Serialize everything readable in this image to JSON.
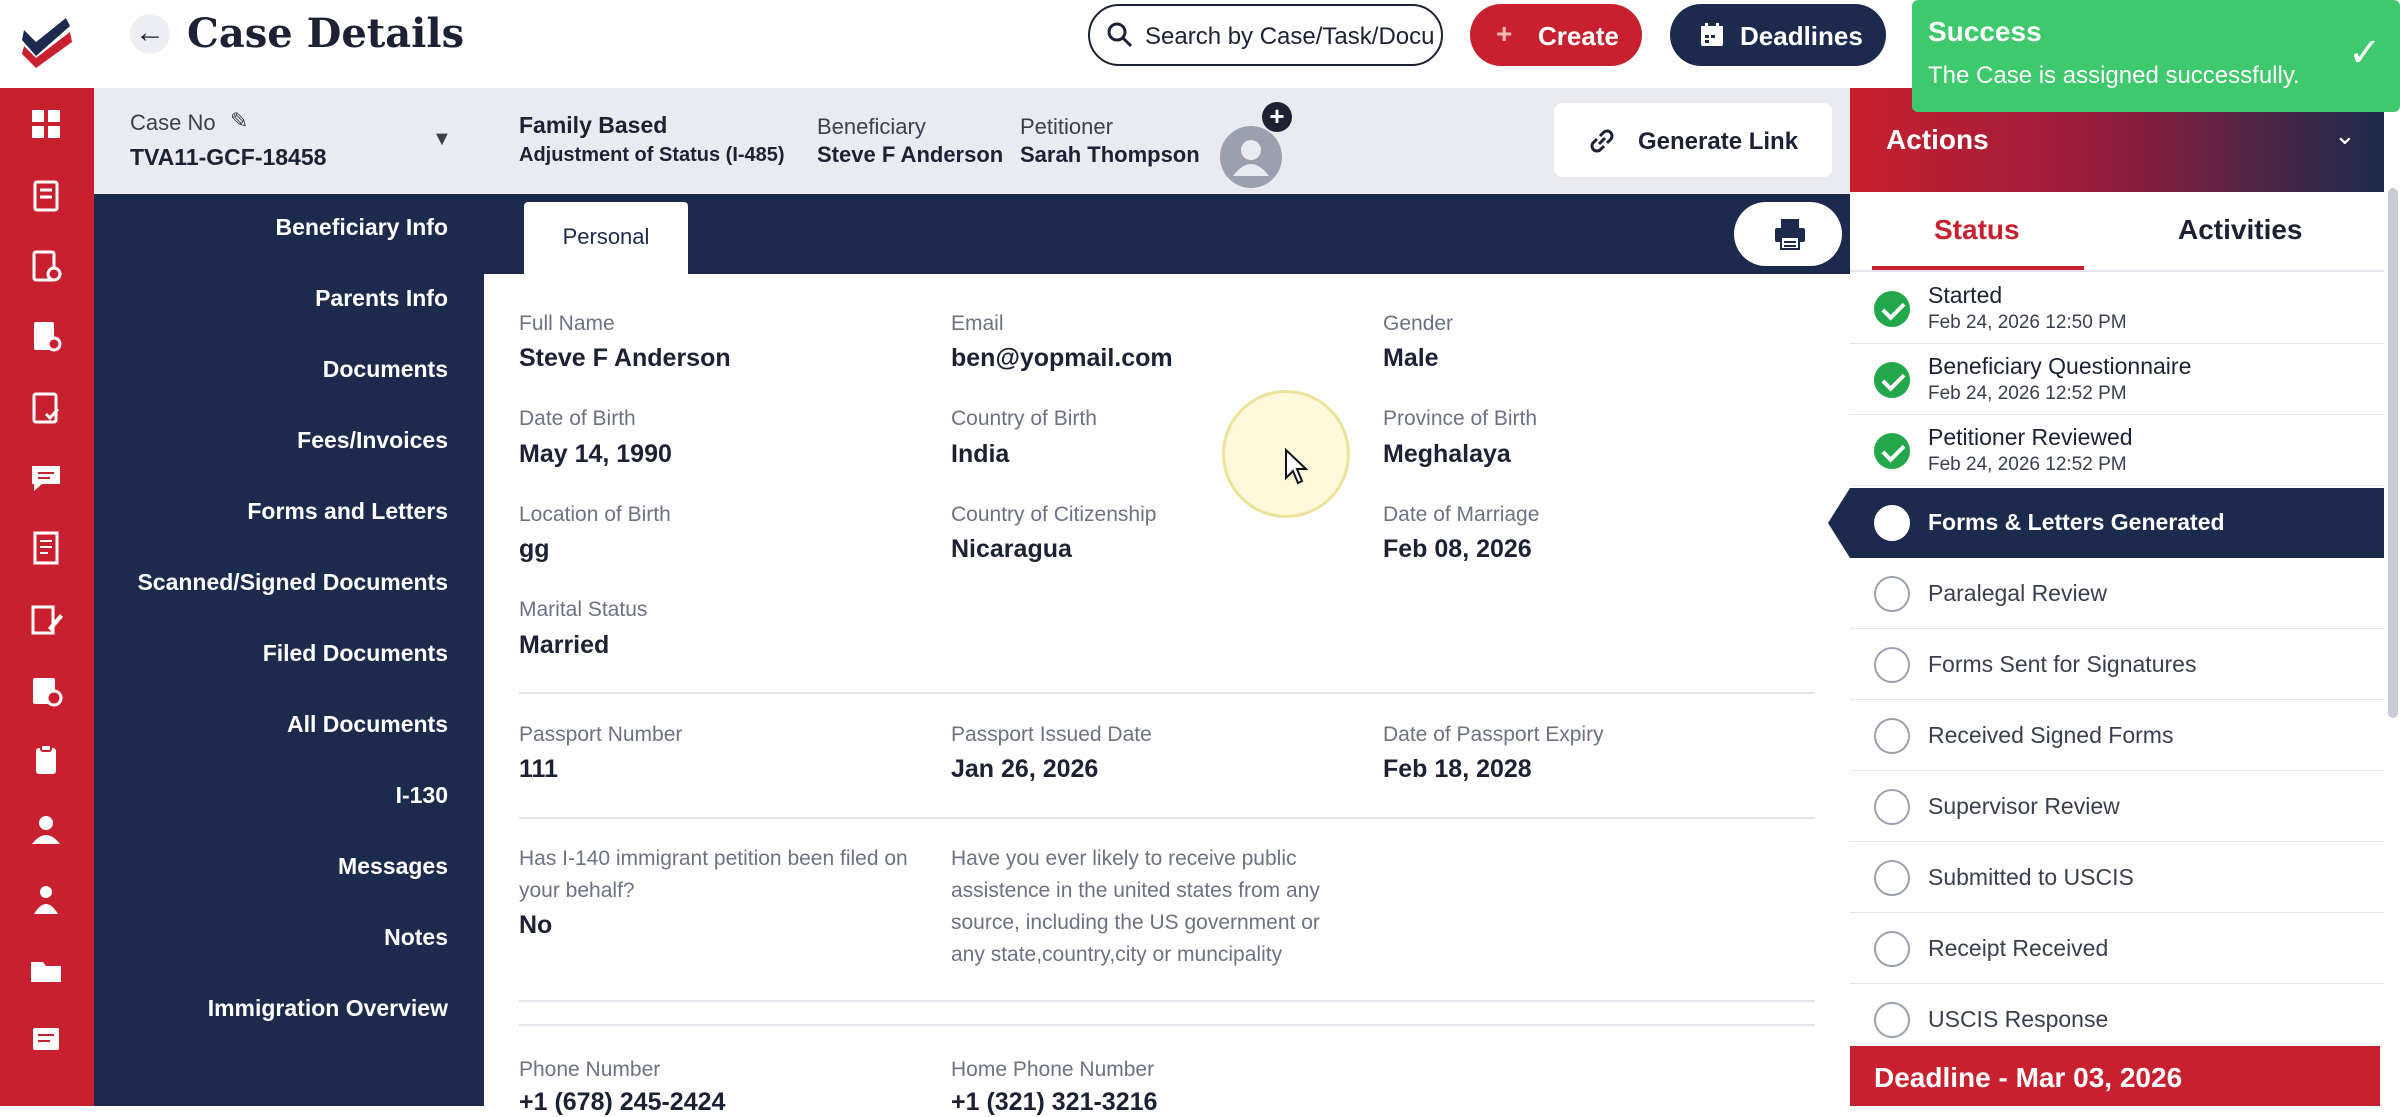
{
  "header": {
    "title": "Case Details",
    "search_placeholder": "Search by Case/Task/Docu",
    "create_label": "Create",
    "deadlines_label": "Deadlines"
  },
  "toast": {
    "title": "Success",
    "message": "The Case is assigned successfully."
  },
  "case": {
    "case_no_label": "Case No",
    "case_no": "TVA11-GCF-18458",
    "type": "Family Based",
    "subtype": "Adjustment of Status (I-485)",
    "beneficiary_label": "Beneficiary",
    "beneficiary": "Steve F Anderson",
    "petitioner_label": "Petitioner",
    "petitioner": "Sarah Thompson",
    "generate_link_label": "Generate Link"
  },
  "sidenav": {
    "items": [
      "Beneficiary Info",
      "Parents Info",
      "Documents",
      "Fees/Invoices",
      "Forms and Letters",
      "Scanned/Signed Documents",
      "Filed Documents",
      "All Documents",
      "I-130",
      "Messages",
      "Notes",
      "Immigration Overview"
    ]
  },
  "main": {
    "tab_personal": "Personal",
    "fields": {
      "full_name": {
        "label": "Full Name",
        "value": "Steve F Anderson"
      },
      "email": {
        "label": "Email",
        "value": "ben@yopmail.com"
      },
      "gender": {
        "label": "Gender",
        "value": "Male"
      },
      "dob": {
        "label": "Date of Birth",
        "value": "May 14, 1990"
      },
      "country_birth": {
        "label": "Country of Birth",
        "value": "India"
      },
      "province_birth": {
        "label": "Province of Birth",
        "value": "Meghalaya"
      },
      "location_birth": {
        "label": "Location of Birth",
        "value": "gg"
      },
      "citizenship": {
        "label": "Country of Citizenship",
        "value": "Nicaragua"
      },
      "marriage_date": {
        "label": "Date of Marriage",
        "value": "Feb 08, 2026"
      },
      "marital": {
        "label": "Marital Status",
        "value": "Married"
      },
      "passport_no": {
        "label": "Passport Number",
        "value": "111"
      },
      "passport_issued": {
        "label": "Passport Issued Date",
        "value": "Jan 26, 2026"
      },
      "passport_expiry": {
        "label": "Date of Passport Expiry",
        "value": "Feb 18, 2028"
      },
      "i140": {
        "label_line1": "Has I-140 immigrant petition been filed on",
        "label_line2": "your behalf?",
        "value": "No"
      },
      "public_assist": {
        "line1": "Have you ever likely to receive public",
        "line2": "assistence in the united states from any",
        "line3": "source, including the US government or",
        "line4": "any state,country,city or muncipality"
      },
      "phone": {
        "label": "Phone Number",
        "value": "+1 (678) 245-2424"
      },
      "home_phone": {
        "label": "Home Phone Number",
        "value": "+1 (321) 321-3216"
      }
    }
  },
  "actions": {
    "title": "Actions",
    "tab_status": "Status",
    "tab_activities": "Activities",
    "steps": [
      {
        "name": "Started",
        "time": "Feb 24, 2026 12:50 PM",
        "state": "done"
      },
      {
        "name": "Beneficiary Questionnaire",
        "time": "Feb 24, 2026 12:52 PM",
        "state": "done"
      },
      {
        "name": "Petitioner Reviewed",
        "time": "Feb 24, 2026 12:52 PM",
        "state": "done"
      },
      {
        "name": "Forms & Letters Generated",
        "state": "current"
      },
      {
        "name": "Paralegal Review",
        "state": "pending"
      },
      {
        "name": "Forms Sent for Signatures",
        "state": "pending"
      },
      {
        "name": "Received Signed Forms",
        "state": "pending"
      },
      {
        "name": "Supervisor Review",
        "state": "pending"
      },
      {
        "name": "Submitted to USCIS",
        "state": "pending"
      },
      {
        "name": "Receipt Received",
        "state": "pending"
      },
      {
        "name": "USCIS Response",
        "state": "pending"
      }
    ],
    "deadline": "Deadline - Mar 03, 2026"
  },
  "colors": {
    "brand_red": "#c8202e",
    "navy": "#1c2b4d",
    "success_green": "#3ec96d"
  }
}
